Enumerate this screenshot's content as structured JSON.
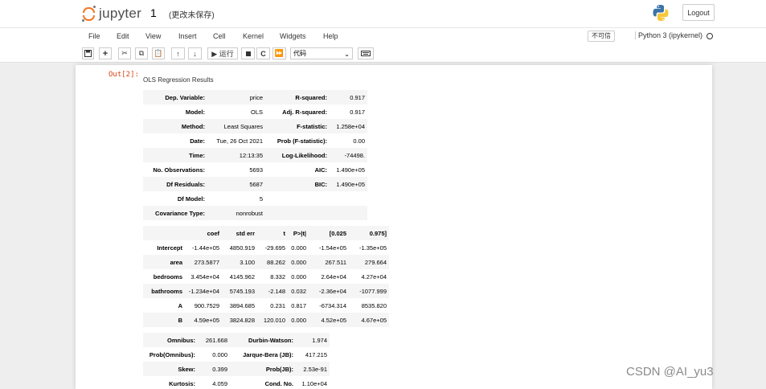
{
  "header": {
    "logo_text": "jupyter",
    "notebook_name": "1",
    "save_status": "(更改未保存)",
    "logout_label": "Logout"
  },
  "menu": [
    "File",
    "Edit",
    "View",
    "Insert",
    "Cell",
    "Kernel",
    "Widgets",
    "Help"
  ],
  "trusted_label": "不可信",
  "kernel_name": "Python 3 (ipykernel)",
  "toolbar": {
    "icons": [
      "save-icon",
      "plus-icon",
      "cut-icon",
      "copy-icon",
      "paste-icon",
      "arrow-up-icon",
      "arrow-down-icon",
      "run-icon",
      "stop-icon",
      "restart-icon",
      "fast-forward-icon",
      "keyboard-icon"
    ],
    "run_label": "▶ 运行",
    "cell_type": "代码"
  },
  "cell": {
    "prompt": "Out[2]:",
    "title": "OLS Regression Results"
  },
  "summary_table": [
    [
      "Dep. Variable:",
      "price",
      "R-squared:",
      "0.917"
    ],
    [
      "Model:",
      "OLS",
      "Adj. R-squared:",
      "0.917"
    ],
    [
      "Method:",
      "Least Squares",
      "F-statistic:",
      "1.258e+04"
    ],
    [
      "Date:",
      "Tue, 26 Oct 2021",
      "Prob (F-statistic):",
      "0.00"
    ],
    [
      "Time:",
      "12:13:35",
      "Log-Likelihood:",
      "-74498."
    ],
    [
      "No. Observations:",
      "5693",
      "AIC:",
      "1.490e+05"
    ],
    [
      "Df Residuals:",
      "5687",
      "BIC:",
      "1.490e+05"
    ],
    [
      "Df Model:",
      "5",
      "",
      ""
    ],
    [
      "Covariance Type:",
      "nonrobust",
      "",
      ""
    ]
  ],
  "coef_table": {
    "headers": [
      "",
      "coef",
      "std err",
      "t",
      "P>|t|",
      "[0.025",
      "0.975]"
    ],
    "rows": [
      [
        "Intercept",
        "-1.44e+05",
        "4850.919",
        "-29.695",
        "0.000",
        "-1.54e+05",
        "-1.35e+05"
      ],
      [
        "area",
        "273.5877",
        "3.100",
        "88.262",
        "0.000",
        "267.511",
        "279.664"
      ],
      [
        "bedrooms",
        "3.454e+04",
        "4145.962",
        "8.332",
        "0.000",
        "2.64e+04",
        "4.27e+04"
      ],
      [
        "bathrooms",
        "-1.234e+04",
        "5745.193",
        "-2.148",
        "0.032",
        "-2.36e+04",
        "-1077.999"
      ],
      [
        "A",
        "900.7529",
        "3894.685",
        "0.231",
        "0.817",
        "-6734.314",
        "8535.820"
      ],
      [
        "B",
        "4.59e+05",
        "3824.828",
        "120.010",
        "0.000",
        "4.52e+05",
        "4.67e+05"
      ]
    ]
  },
  "diag_table": [
    [
      "Omnibus:",
      "261.668",
      "Durbin-Watson:",
      "1.974"
    ],
    [
      "Prob(Omnibus):",
      "0.000",
      "Jarque-Bera (JB):",
      "417.215"
    ],
    [
      "Skew:",
      "0.399",
      "Prob(JB):",
      "2.53e-91"
    ],
    [
      "Kurtosis:",
      "4.059",
      "Cond. No.",
      "1.10e+04"
    ]
  ],
  "watermark": "CSDN @AI_yu3",
  "colors": {
    "jupyter_orange": "#f37726",
    "prompt_red": "#d84315",
    "row_stripe": "#f5f5f5"
  }
}
